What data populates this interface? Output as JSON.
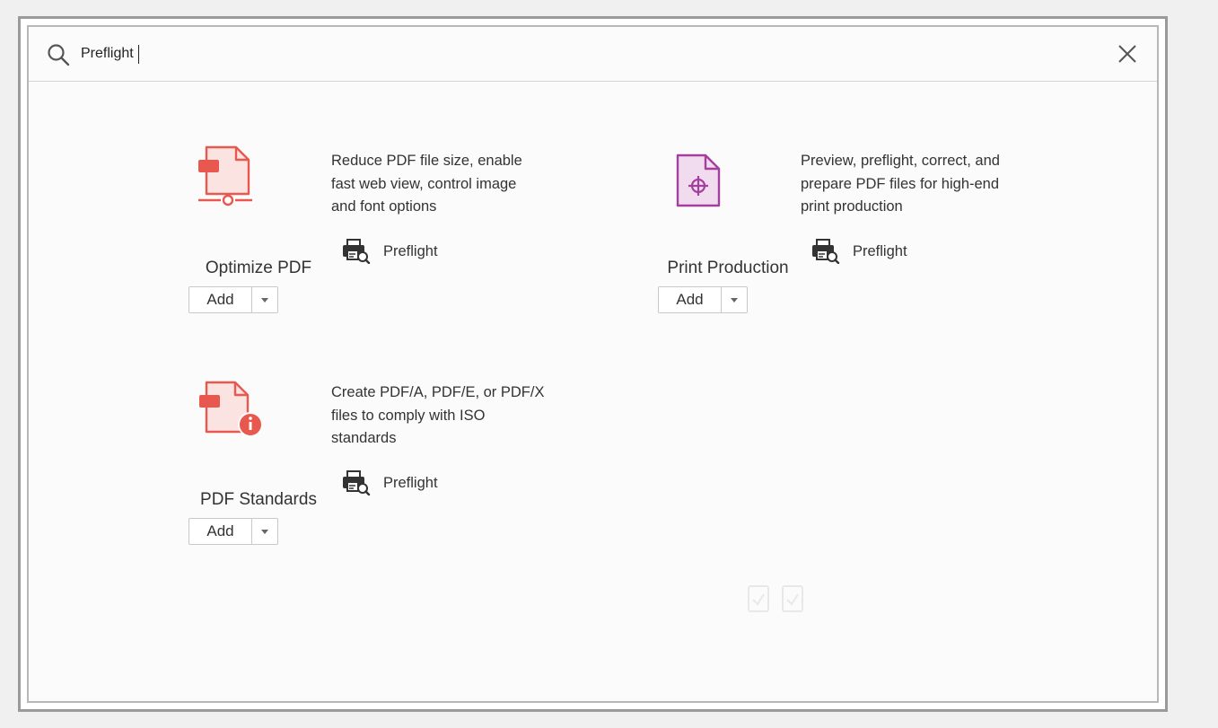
{
  "search": {
    "value": "Preflight"
  },
  "tools": [
    {
      "name": "Optimize PDF",
      "description": "Reduce PDF file size, enable fast web view, control image and font options",
      "desc_lines": [
        "Reduce PDF file size, enable",
        "fast web view, control image",
        "and font options"
      ],
      "match_label": "Preflight",
      "add_label": "Add",
      "icon": "optimize-pdf-icon",
      "color": "#e8584f"
    },
    {
      "name": "Print Production",
      "description": "Preview, preflight, correct, and prepare PDF files for high-end print production",
      "desc_lines": [
        "Preview, preflight, correct, and",
        "prepare PDF files for high-end",
        "print production"
      ],
      "match_label": "Preflight",
      "add_label": "Add",
      "icon": "print-production-icon",
      "color": "#a43f9e"
    },
    {
      "name": "PDF Standards",
      "description": "Create PDF/A, PDF/E, or PDF/X files to comply with ISO standards",
      "desc_lines": [
        "Create PDF/A, PDF/E, or PDF/X",
        "files to comply with ISO",
        "standards"
      ],
      "match_label": "Preflight",
      "add_label": "Add",
      "icon": "pdf-standards-icon",
      "color": "#e8584f"
    }
  ],
  "colors": {
    "accent_blue": "#3c7bd6",
    "text": "#333333",
    "border": "#c8c8c8"
  }
}
